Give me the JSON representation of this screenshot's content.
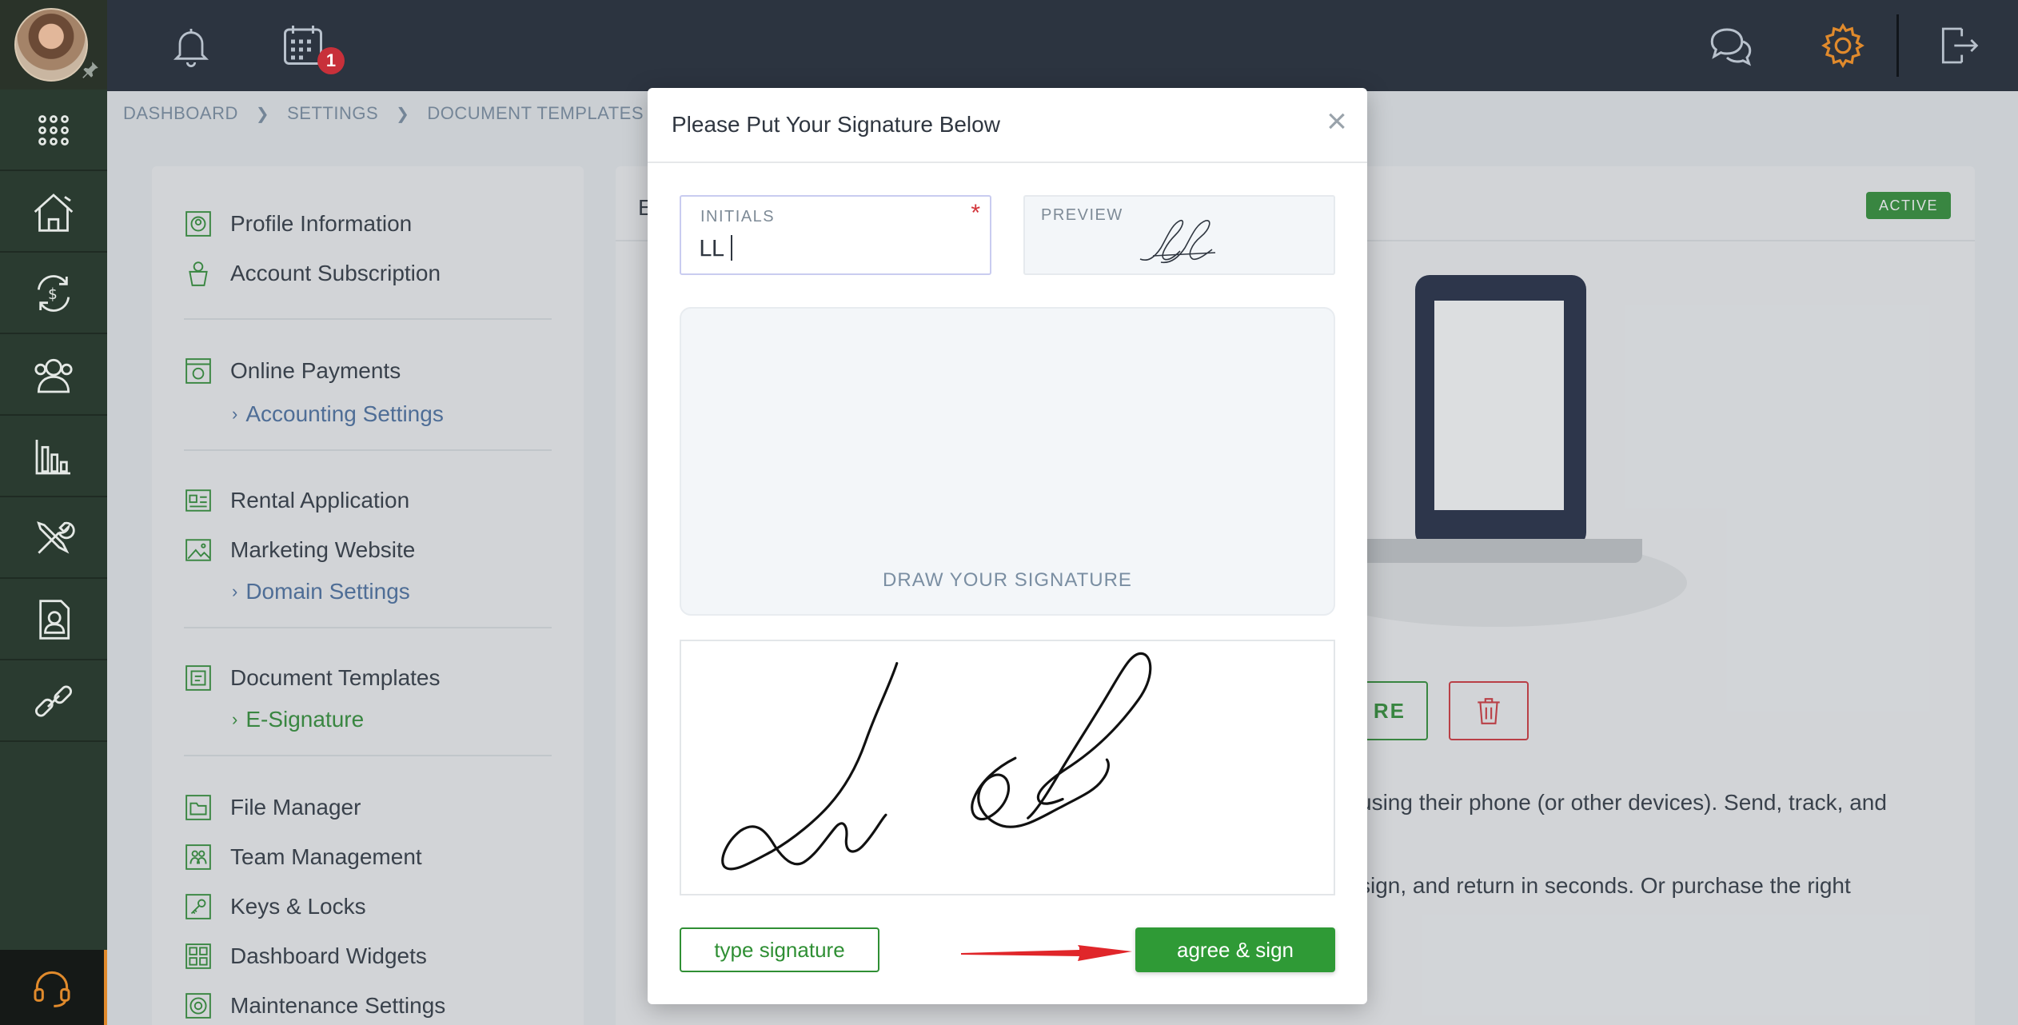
{
  "colors": {
    "accent_green": "#2f9a36",
    "danger_red": "#d3343a",
    "topbar_bg": "#2c3440",
    "rail_bg": "#2a3b30",
    "settings_orange": "#e08a2c"
  },
  "topbar": {
    "calendar_badge": "1",
    "icons": [
      "bell-icon",
      "calendar-icon",
      "chat-icon",
      "gear-icon",
      "logout-icon"
    ]
  },
  "rail": {
    "icons": [
      "apps-grid-icon",
      "properties-icon",
      "payments-icon",
      "people-icon",
      "reports-icon",
      "maintenance-icon",
      "tenant-icon",
      "link-icon",
      "support-headset-icon"
    ]
  },
  "breadcrumb": {
    "items": [
      "DASHBOARD",
      "SETTINGS",
      "DOCUMENT TEMPLATES"
    ]
  },
  "settings_menu": {
    "profile": "Profile Information",
    "subscription": "Account Subscription",
    "online_payments": "Online Payments",
    "accounting": "Accounting Settings",
    "rental_application": "Rental Application",
    "marketing_website": "Marketing Website",
    "domain_settings": "Domain Settings",
    "document_templates": "Document Templates",
    "e_signature": "E-Signature",
    "file_manager": "File Manager",
    "team_management": "Team Management",
    "keys_locks": "Keys & Locks",
    "dashboard_widgets": "Dashboard Widgets",
    "maintenance_settings": "Maintenance Settings"
  },
  "content": {
    "title_fragment": "E",
    "status": "ACTIVE",
    "button_fragment": "RE",
    "text_line_1": "using their phone (or other devices). Send, track, and",
    "text_line_2": "sign, and return in seconds. Or purchase the right"
  },
  "modal": {
    "title": "Please Put Your Signature Below",
    "close": "×",
    "initials_label": "INITIALS",
    "initials_required": "*",
    "initials_value": "LL",
    "preview_label": "PREVIEW",
    "draw_hint": "DRAW YOUR SIGNATURE",
    "type_signature": "type signature",
    "agree_sign": "agree & sign"
  }
}
